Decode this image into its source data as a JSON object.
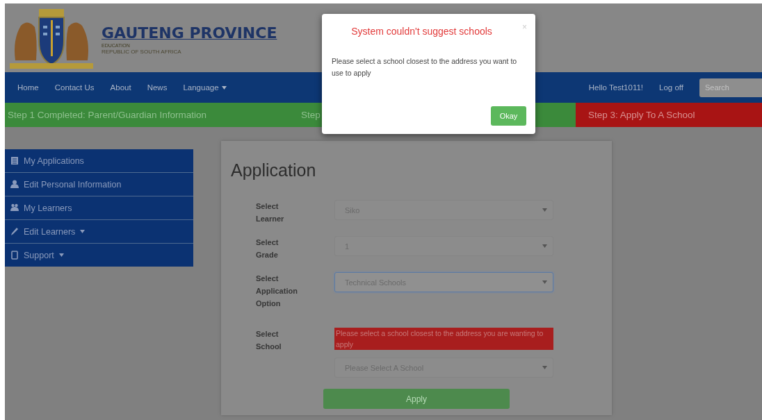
{
  "header": {
    "title": "GAUTENG PROVINCE",
    "subtitle": "EDUCATION",
    "country": "REPUBLIC OF SOUTH AFRICA"
  },
  "nav": {
    "links": [
      {
        "label": "Home",
        "dropdown": false
      },
      {
        "label": "Contact Us",
        "dropdown": false
      },
      {
        "label": "About",
        "dropdown": false
      },
      {
        "label": "News",
        "dropdown": false
      },
      {
        "label": "Language",
        "dropdown": true
      }
    ],
    "greeting": "Hello Test1011!",
    "logoff": "Log off",
    "search": {
      "placeholder": "Search"
    }
  },
  "steps": [
    {
      "label": "Step 1 Completed: Parent/Guardian Information",
      "kind": "done"
    },
    {
      "label": "Step",
      "kind": "done"
    },
    {
      "label": "Step 3: Apply To A School",
      "kind": "current"
    }
  ],
  "sidebar": {
    "items": [
      {
        "label": "My Applications",
        "dropdown": false
      },
      {
        "label": "Edit Personal Information",
        "dropdown": false
      },
      {
        "label": "My Learners",
        "dropdown": false
      },
      {
        "label": "Edit Learners",
        "dropdown": true
      },
      {
        "label": "Support",
        "dropdown": true
      }
    ]
  },
  "form": {
    "title": "Application",
    "fields": [
      {
        "label": "Select Learner",
        "value": "Siko",
        "focused": false
      },
      {
        "label": "Select Grade",
        "value": "1",
        "focused": false
      },
      {
        "label": "Select Application Option",
        "value": "Technical Schools",
        "focused": true
      },
      {
        "label": "Select School",
        "value": "Please Select A School",
        "focused": false,
        "error": "Please select a school closest to the address you are wanting to apply"
      }
    ],
    "submit": {
      "label": "Apply",
      "disabled": true
    }
  },
  "modal": {
    "title": "System couldn't suggest schools",
    "close": "×",
    "message": "Please select a school closest to the address you want to use to apply",
    "button": "Okay"
  }
}
